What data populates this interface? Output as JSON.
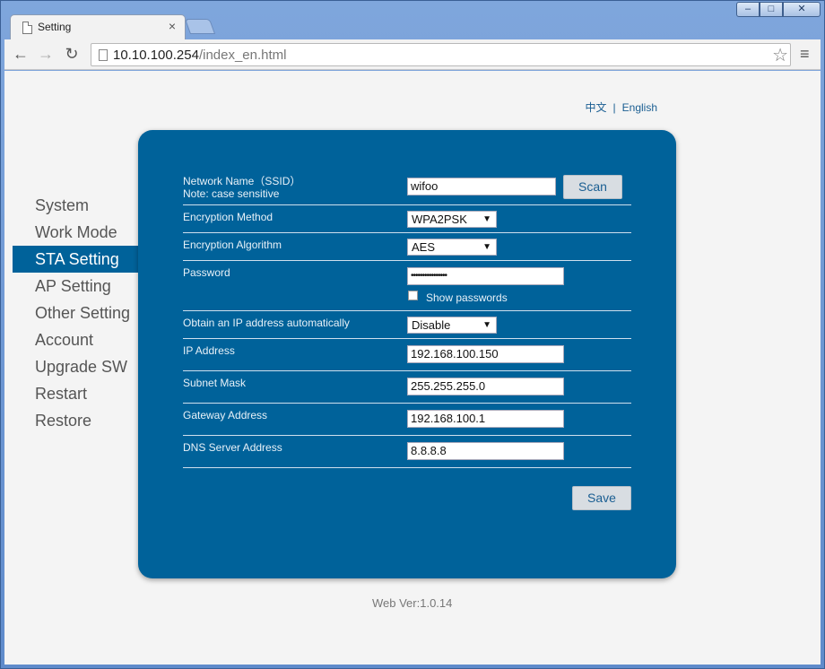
{
  "browser": {
    "tab_title": "Setting",
    "tab_close": "×",
    "url_host": "10.10.100.254",
    "url_path": "/index_en.html",
    "window_buttons": {
      "minimize": "–",
      "maximize": "□",
      "close": "✕"
    },
    "nav": {
      "back": "←",
      "forward": "→",
      "reload": "↻",
      "star": "☆",
      "menu": "≡"
    }
  },
  "lang": {
    "chinese": "中文",
    "sep": "|",
    "english": "English"
  },
  "sidebar": {
    "items": [
      {
        "label": "System"
      },
      {
        "label": "Work Mode"
      },
      {
        "label": "STA Setting",
        "active": true
      },
      {
        "label": "AP Setting"
      },
      {
        "label": "Other Setting"
      },
      {
        "label": "Account"
      },
      {
        "label": "Upgrade SW"
      },
      {
        "label": "Restart"
      },
      {
        "label": "Restore"
      }
    ]
  },
  "form": {
    "ssid_label": "Network Name（SSID）",
    "ssid_note": "Note: case sensitive",
    "ssid_value": "wifoo",
    "scan_label": "Scan",
    "encryption_method_label": "Encryption Method",
    "encryption_method_value": "WPA2PSK",
    "encryption_algorithm_label": "Encryption Algorithm",
    "encryption_algorithm_value": "AES",
    "password_label": "Password",
    "password_value": "••••••••••••••••",
    "show_passwords_label": "Show passwords",
    "dhcp_label": "Obtain an IP address automatically",
    "dhcp_value": "Disable",
    "ip_label": "IP Address",
    "ip_value": "192.168.100.150",
    "subnet_label": "Subnet Mask",
    "subnet_value": "255.255.255.0",
    "gateway_label": "Gateway Address",
    "gateway_value": "192.168.100.1",
    "dns_label": "DNS Server Address",
    "dns_value": "8.8.8.8",
    "save_label": "Save",
    "select_arrow": "▼"
  },
  "footer": {
    "version": "Web Ver:1.0.14"
  },
  "colors": {
    "panel": "#00629a",
    "active_nav": "#00629a",
    "link": "#1a5e92",
    "page_bg": "#f4f4f4"
  }
}
